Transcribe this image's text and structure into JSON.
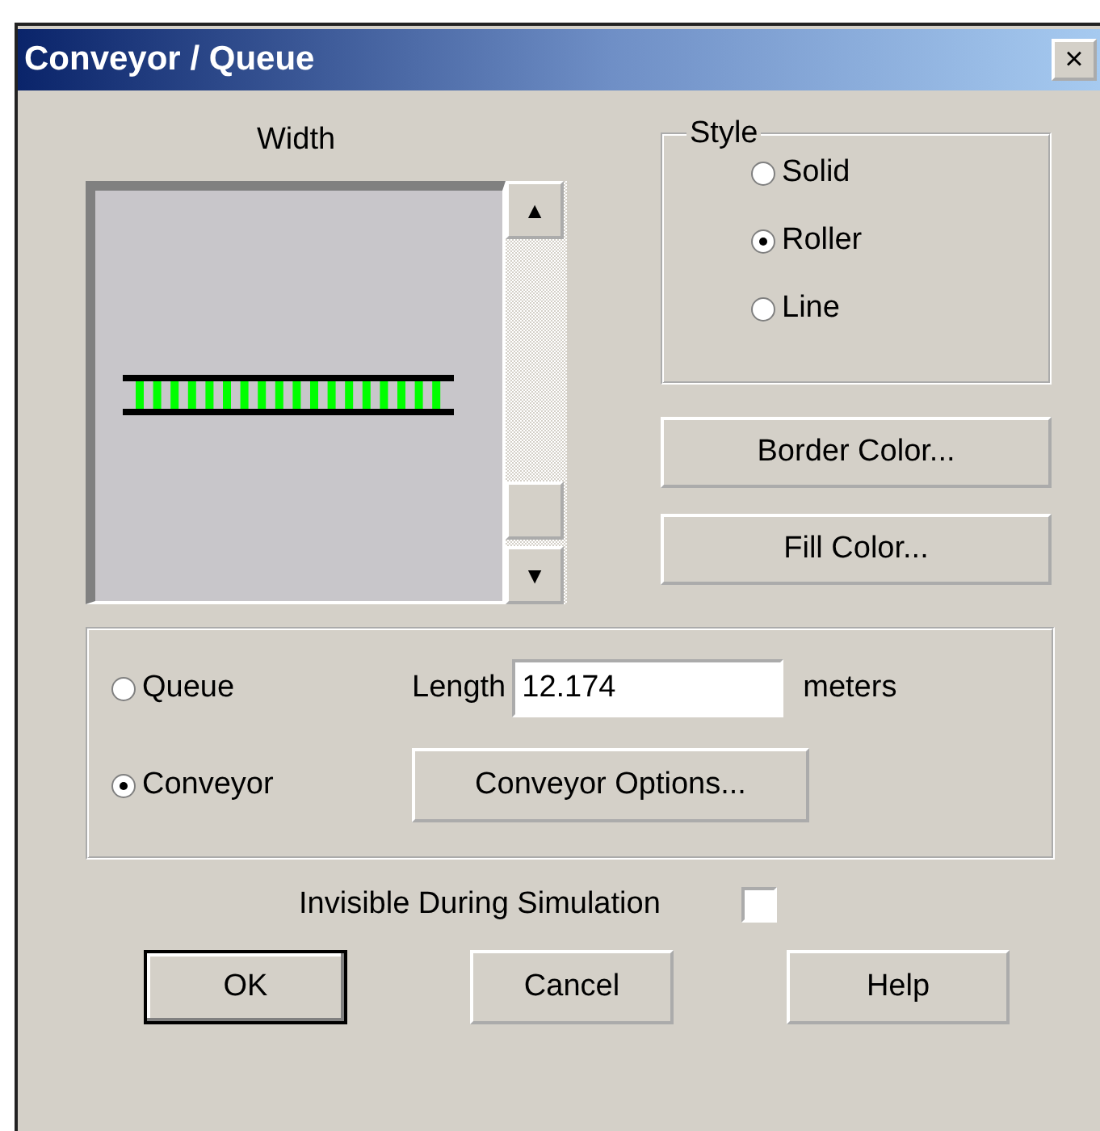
{
  "window": {
    "title": "Conveyor / Queue",
    "close": "×"
  },
  "width_preview": {
    "label": "Width",
    "scroll_up": "▲",
    "scroll_down": "▼"
  },
  "style_group": {
    "title": "Style",
    "options": [
      {
        "label": "Solid",
        "selected": false
      },
      {
        "label": "Roller",
        "selected": true
      },
      {
        "label": "Line",
        "selected": false
      }
    ]
  },
  "color_buttons": [
    "Border Color...",
    "Fill Color..."
  ],
  "type_group": {
    "options": [
      {
        "label": "Queue",
        "selected": false
      },
      {
        "label": "Conveyor",
        "selected": true
      }
    ],
    "length_label": "Length",
    "length_value": "12.174",
    "length_unit": "meters",
    "options_button": "Conveyor Options..."
  },
  "invisible": {
    "label": "Invisible During Simulation",
    "checked": false
  },
  "buttons": [
    {
      "label": "OK",
      "default": true
    },
    {
      "label": "Cancel",
      "default": false
    },
    {
      "label": "Help",
      "default": false
    }
  ]
}
